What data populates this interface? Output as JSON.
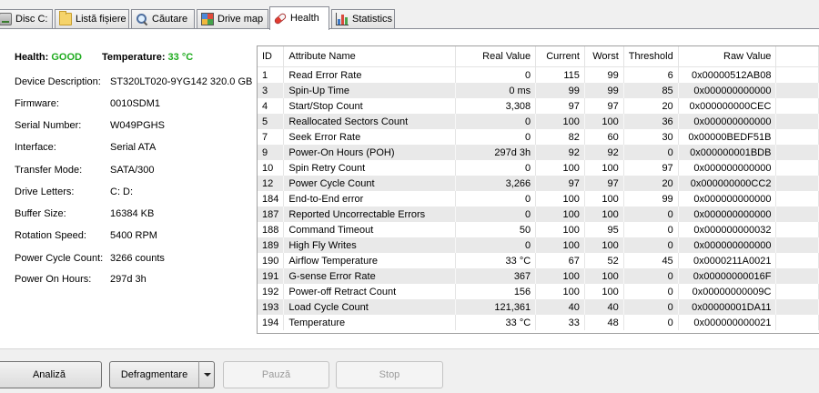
{
  "tabs": [
    {
      "label": "Disc C:",
      "icon": "disk-icon"
    },
    {
      "label": "Listă fișiere",
      "icon": "folder-icon"
    },
    {
      "label": "Căutare",
      "icon": "search-icon"
    },
    {
      "label": "Drive map",
      "icon": "drive-map-icon"
    },
    {
      "label": "Health",
      "icon": "health-pill-icon",
      "active": true
    },
    {
      "label": "Statistics",
      "icon": "statistics-icon"
    }
  ],
  "summary": {
    "health_label": "Health:",
    "health_value": "GOOD",
    "temperature_label": "Temperature:",
    "temperature_value": "33 °C",
    "status_color": "#1fab1f"
  },
  "info": [
    {
      "label": "Device Description:",
      "value": "ST320LT020-9YG142 320.0 GB"
    },
    {
      "label": "Firmware:",
      "value": "0010SDM1"
    },
    {
      "label": "Serial Number:",
      "value": "W049PGHS"
    },
    {
      "label": "Interface:",
      "value": "Serial ATA"
    },
    {
      "label": "Transfer Mode:",
      "value": "SATA/300"
    },
    {
      "label": "Drive Letters:",
      "value": "C: D:"
    },
    {
      "label": "Buffer Size:",
      "value": "16384 KB"
    },
    {
      "label": "Rotation Speed:",
      "value": "5400 RPM"
    },
    {
      "label": "Power Cycle Count:",
      "value": "3266 counts"
    },
    {
      "label": "Power On Hours:",
      "value": "297d 3h"
    }
  ],
  "table": {
    "columns": [
      "ID",
      "Attribute Name",
      "Real Value",
      "Current",
      "Worst",
      "Threshold",
      "Raw Value"
    ],
    "rows": [
      [
        "1",
        "Read Error Rate",
        "0",
        "115",
        "99",
        "6",
        "0x00000512AB08"
      ],
      [
        "3",
        "Spin-Up Time",
        "0 ms",
        "99",
        "99",
        "85",
        "0x000000000000"
      ],
      [
        "4",
        "Start/Stop Count",
        "3,308",
        "97",
        "97",
        "20",
        "0x000000000CEC"
      ],
      [
        "5",
        "Reallocated Sectors Count",
        "0",
        "100",
        "100",
        "36",
        "0x000000000000"
      ],
      [
        "7",
        "Seek Error Rate",
        "0",
        "82",
        "60",
        "30",
        "0x00000BEDF51B"
      ],
      [
        "9",
        "Power-On Hours (POH)",
        "297d 3h",
        "92",
        "92",
        "0",
        "0x000000001BDB"
      ],
      [
        "10",
        "Spin Retry Count",
        "0",
        "100",
        "100",
        "97",
        "0x000000000000"
      ],
      [
        "12",
        "Power Cycle Count",
        "3,266",
        "97",
        "97",
        "20",
        "0x000000000CC2"
      ],
      [
        "184",
        "End-to-End error",
        "0",
        "100",
        "100",
        "99",
        "0x000000000000"
      ],
      [
        "187",
        "Reported Uncorrectable Errors",
        "0",
        "100",
        "100",
        "0",
        "0x000000000000"
      ],
      [
        "188",
        "Command Timeout",
        "50",
        "100",
        "95",
        "0",
        "0x000000000032"
      ],
      [
        "189",
        "High Fly Writes",
        "0",
        "100",
        "100",
        "0",
        "0x000000000000"
      ],
      [
        "190",
        "Airflow Temperature",
        "33 °C",
        "67",
        "52",
        "45",
        "0x0000211A0021"
      ],
      [
        "191",
        "G-sense Error Rate",
        "367",
        "100",
        "100",
        "0",
        "0x00000000016F"
      ],
      [
        "192",
        "Power-off Retract Count",
        "156",
        "100",
        "100",
        "0",
        "0x00000000009C"
      ],
      [
        "193",
        "Load Cycle Count",
        "121,361",
        "40",
        "40",
        "0",
        "0x00000001DA11"
      ],
      [
        "194",
        "Temperature",
        "33 °C",
        "33",
        "48",
        "0",
        "0x000000000021"
      ]
    ]
  },
  "buttons": {
    "analyze": "Analiză",
    "defragment": "Defragmentare",
    "pause": "Pauză",
    "stop": "Stop"
  }
}
